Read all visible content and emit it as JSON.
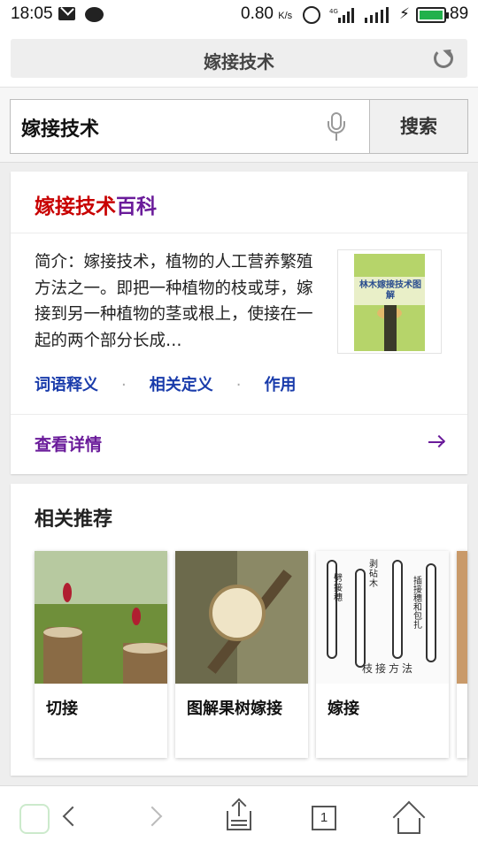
{
  "status_bar": {
    "time": "18:05",
    "speed": "0.80",
    "speed_unit": "K/s",
    "network": "4G",
    "battery": "89"
  },
  "browser": {
    "page_title": "嫁接技术",
    "search_value": "嫁接技术",
    "search_button": "搜索"
  },
  "baike": {
    "keyword": "嫁接技术",
    "suffix": "百科",
    "summary": "简介：嫁接技术，植物的人工营养繁殖方法之一。即把一种植物的枝或芽，嫁接到另一种植物的茎或根上，使接在一起的两个部分长成…",
    "book_title": "林木嫁接技术图解",
    "links": [
      "词语释义",
      "相关定义",
      "作用"
    ],
    "more": "查看详情"
  },
  "related": {
    "title": "相关推荐",
    "items": [
      {
        "label": "切接"
      },
      {
        "label": "图解果树嫁接"
      },
      {
        "label": "嫁接"
      }
    ],
    "diagram_caption": "枝接方法",
    "diagram_labels": [
      "劈接穗",
      "剥砧木",
      "插接穗和包扎"
    ]
  },
  "colors": {
    "keyword_red": "#c80000",
    "visited_purple": "#6a1b9a",
    "link_blue": "#1a3cab",
    "battery_green": "#22b14c"
  }
}
